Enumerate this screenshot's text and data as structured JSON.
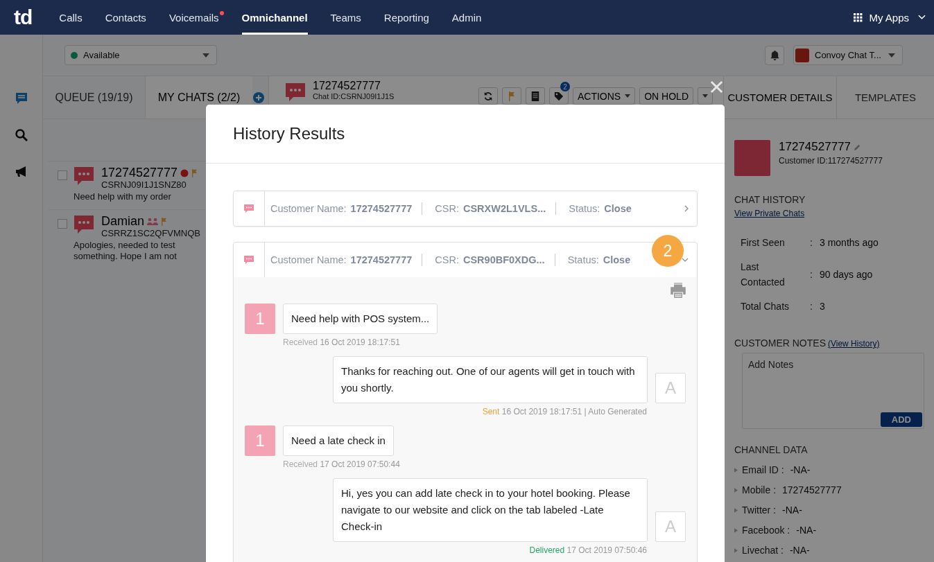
{
  "nav": {
    "logo": "td",
    "items": [
      {
        "label": "Calls",
        "selected": false,
        "badge": false
      },
      {
        "label": "Contacts",
        "selected": false,
        "badge": false
      },
      {
        "label": "Voicemails",
        "selected": false,
        "badge": true
      },
      {
        "label": "Omnichannel",
        "selected": true,
        "badge": false
      },
      {
        "label": "Teams",
        "selected": false,
        "badge": false
      },
      {
        "label": "Reporting",
        "selected": false,
        "badge": false
      },
      {
        "label": "Admin",
        "selected": false,
        "badge": false
      }
    ],
    "apps": "My Apps"
  },
  "status_select": {
    "value": "Available"
  },
  "team_select": {
    "value": "Convoy Chat T..."
  },
  "chat_tabs": [
    {
      "label": "QUEUE (19/19)",
      "selected": false
    },
    {
      "label": "MY CHATS (2/2)",
      "selected": true
    }
  ],
  "chats": [
    {
      "kind": "individual",
      "name": "17274527777",
      "id": "CSRNJ09I1J1SNZ80",
      "preview": "Need help with my order",
      "checked": false
    },
    {
      "kind": "group",
      "name": "Damian",
      "id": "CSRRZ1SC2QFVMNQB",
      "preview": "Apologies, needed to test something. Hope I am not",
      "checked": false
    }
  ],
  "conversation": {
    "number": "17274527777",
    "chat_id": "Chat ID:CSRNJ09I1J1S",
    "tag_count": "2",
    "actions": "ACTIONS",
    "hold": "ON HOLD"
  },
  "details_tabs": [
    {
      "label": "CUSTOMER DETAILS",
      "selected": true
    },
    {
      "label": "TEMPLATES",
      "selected": false
    }
  ],
  "customer": {
    "name": "17274527777",
    "customer_id": "Customer ID:117274527777",
    "history_heading": "CHAT HISTORY",
    "private_link": "View Private Chats",
    "stats": [
      {
        "label": "First Seen",
        "separator": ":",
        "value": "3 months ago"
      },
      {
        "label": "Last Contacted",
        "separator": ":",
        "value": "90 days ago"
      },
      {
        "label": "Total Chats",
        "separator": ":",
        "value": "3"
      }
    ],
    "notes_heading": "CUSTOMER NOTES",
    "notes_link": "(View History)",
    "notes_placeholder": "Add Notes",
    "add_button": "ADD",
    "channel_heading": "CHANNEL DATA",
    "channels": [
      {
        "label": "Email ID :",
        "value": "-NA-"
      },
      {
        "label": "Mobile :",
        "value": "17274527777"
      },
      {
        "label": "Twitter :",
        "value": "-NA-"
      },
      {
        "label": "Facebook :",
        "value": "-NA-"
      },
      {
        "label": "Livechat :",
        "value": "-NA-"
      }
    ]
  },
  "modal": {
    "title": "History Results",
    "entries": [
      {
        "name_label": "Customer Name:",
        "name": "17274527777",
        "csr_label": "CSR:",
        "csr": "CSRXW2L1VLS...",
        "status_label": "Status:",
        "status": "Close",
        "expanded": false
      },
      {
        "name_label": "Customer Name:",
        "name": "17274527777",
        "csr_label": "CSR:",
        "csr": "CSR90BF0XDG...",
        "status_label": "Status:",
        "status": "Close",
        "expanded": true,
        "step": "2"
      }
    ],
    "messages": [
      {
        "kind": "received",
        "avatar": "1",
        "text": "Need help with POS system...",
        "status": "Received",
        "color": "#aaaaaa",
        "time": "16 Oct 2019 18:17:51"
      },
      {
        "kind": "sent",
        "avatar": "A",
        "text": "Thanks for reaching out. One of our agents will get in touch with you shortly.",
        "status": "Sent",
        "color": "#f0a030",
        "time": "16 Oct 2019 18:17:51 | Auto Generated"
      },
      {
        "kind": "received",
        "avatar": "1",
        "text": "Need a late check in",
        "status": "Received",
        "color": "#aaaaaa",
        "time": "17 Oct 2019 07:50:44"
      },
      {
        "kind": "sent",
        "avatar": "A",
        "text": "Hi, yes you can add late check in to your hotel booking. Please navigate to our website and click on the tab labeled -Late Check-in",
        "status": "Delivered",
        "color": "#22a861",
        "time": "17 Oct 2019 07:50:46"
      }
    ]
  }
}
